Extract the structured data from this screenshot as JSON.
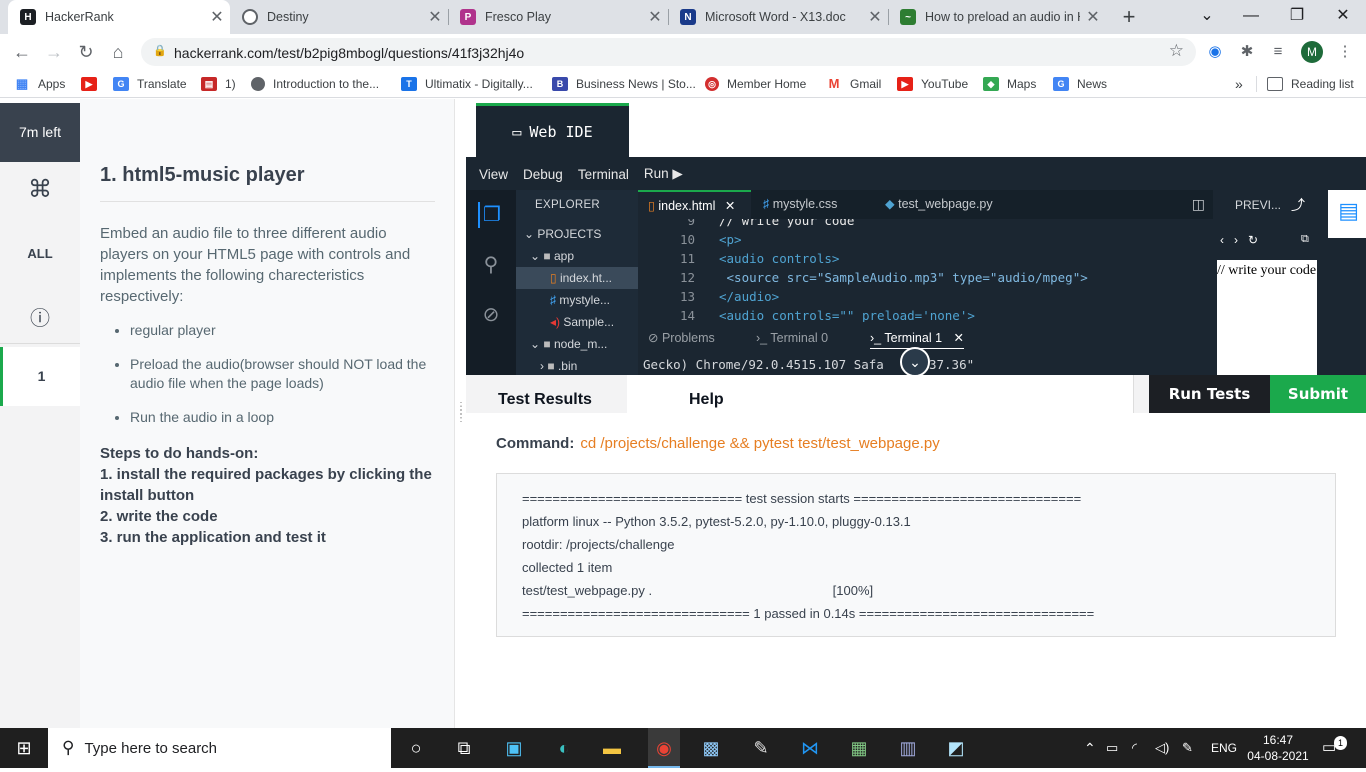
{
  "browser": {
    "tabs": [
      {
        "title": "HackerRank",
        "favicon_color": "#1c1f24",
        "favicon_text": "H"
      },
      {
        "title": "Destiny",
        "favicon_color": "#5f6368",
        "favicon_text": ""
      },
      {
        "title": "Fresco Play",
        "favicon_color": "#b0338c",
        "favicon_text": "P"
      },
      {
        "title": "Microsoft Word - X13.doc",
        "favicon_color": "#1a3a8a",
        "favicon_text": "N"
      },
      {
        "title": "How to preload an audio in H",
        "favicon_color": "#2e7d32",
        "favicon_text": "~"
      }
    ],
    "url": "hackerrank.com/test/b2pig8mbogl/questions/41f3j32hj4o",
    "profile_initial": "M",
    "bookmarks": [
      {
        "label": "Apps",
        "color": "#4285f4"
      },
      {
        "label": "",
        "color": "#e62117"
      },
      {
        "label": "Translate",
        "color": "#4285f4"
      },
      {
        "label": "1)",
        "color": "#c62828"
      },
      {
        "label": "Introduction to the...",
        "color": "#5f6368"
      },
      {
        "label": "Ultimatix - Digitally...",
        "color": "#1a73e8"
      },
      {
        "label": "Business News | Sto...",
        "color": "#3949ab"
      },
      {
        "label": "Member Home",
        "color": "#d32f2f"
      },
      {
        "label": "Gmail",
        "color": "#ea4335"
      },
      {
        "label": "YouTube",
        "color": "#e62117"
      },
      {
        "label": "Maps",
        "color": "#34a853"
      },
      {
        "label": "News",
        "color": "#4285f4"
      }
    ],
    "more_bookmarks": "»",
    "reading_list": "Reading list"
  },
  "sidebar": {
    "time_left": "7m left",
    "cmd_icon": "⌘",
    "all_label": "ALL",
    "info_icon": "ⓘ",
    "question_number": "1"
  },
  "question": {
    "title": "1. html5-music player",
    "description": "Embed an audio file to three different audio players on your HTML5 page with controls and implements the following charecteristics respectively:",
    "bullets": [
      "regular player",
      "Preload the audio(browser should NOT load the audio file when the page loads)",
      "Run the audio in a loop"
    ],
    "steps_heading": "Steps to do hands-on:",
    "steps": [
      "1. install the required packages by clicking the install button",
      "2. write the code",
      "3. run the application and test it"
    ]
  },
  "ide": {
    "title": "Web IDE",
    "menu": [
      "View",
      "Debug",
      "Terminal",
      "Run ▶"
    ],
    "explorer_title": "EXPLORER",
    "tree": [
      {
        "label": "PROJECTS",
        "indent": 0,
        "kind": "root"
      },
      {
        "label": "app",
        "indent": 1,
        "kind": "folder"
      },
      {
        "label": "index.ht...",
        "indent": 2,
        "kind": "html",
        "selected": true
      },
      {
        "label": "mystyle...",
        "indent": 2,
        "kind": "css"
      },
      {
        "label": "Sample...",
        "indent": 2,
        "kind": "audio"
      },
      {
        "label": "node_m...",
        "indent": 1,
        "kind": "folder"
      },
      {
        "label": ".bin",
        "indent": 2,
        "kind": "folder"
      }
    ],
    "editor_tabs": [
      "index.html",
      "mystyle.css",
      "test_webpage.py"
    ],
    "code_lines": [
      {
        "n": "9",
        "text": "// write your code"
      },
      {
        "n": "10",
        "text": "<p>"
      },
      {
        "n": "11",
        "text": "<audio controls>"
      },
      {
        "n": "12",
        "text": " <source src=\"SampleAudio.mp3\" type=\"audio/mpeg\">"
      },
      {
        "n": "13",
        "text": "</audio>"
      },
      {
        "n": "14",
        "text": "<audio controls=\"\" preload='none'>"
      }
    ],
    "panel_tabs": [
      "Problems",
      "Terminal 0",
      "Terminal 1"
    ],
    "terminal_text": "Gecko) Chrome/92.0.4515.107 Safa      37.36\"",
    "preview_title": "PREVI...",
    "preview_text": "// write your code"
  },
  "results": {
    "tabs": [
      "Test Results",
      "Help"
    ],
    "run_tests": "Run Tests",
    "submit": "Submit",
    "command_label": "Command:",
    "command": "cd /projects/challenge && pytest test/test_webpage.py",
    "output": [
      "============================= test session starts ==============================",
      "platform linux -- Python 3.5.2, pytest-5.2.0, py-1.10.0, pluggy-0.13.1",
      "rootdir: /projects/challenge",
      "collected 1 item",
      "test/test_webpage.py .                                                  [100%]",
      "============================== 1 passed in 0.14s ==============================="
    ]
  },
  "taskbar": {
    "search_placeholder": "Type here to search",
    "language": "ENG",
    "time": "16:47",
    "date": "04-08-2021",
    "notification_count": "1"
  },
  "colors": {
    "accent_green": "#1ba94c",
    "ide_bg": "#1b2631",
    "command_orange": "#e67e22"
  }
}
